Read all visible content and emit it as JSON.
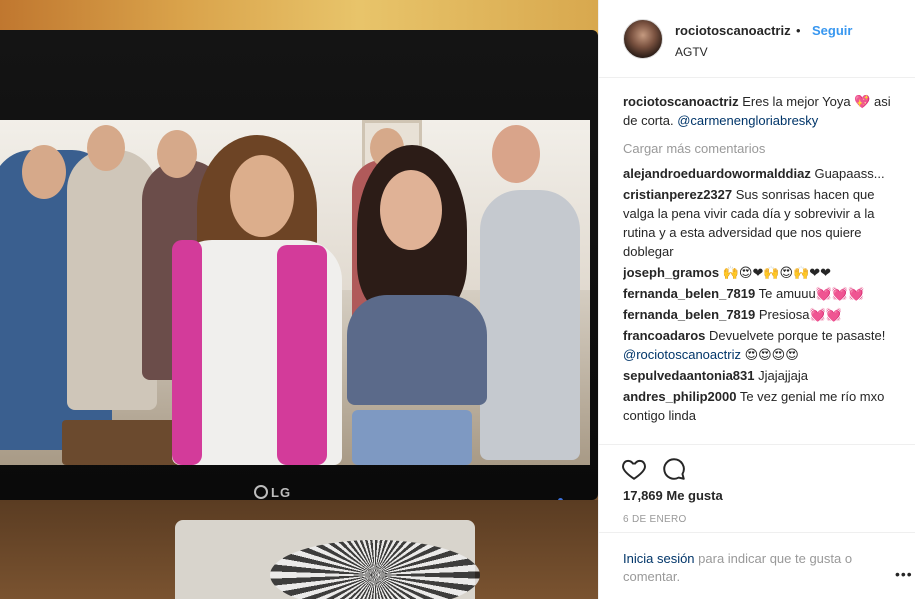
{
  "post": {
    "username": "rociotoscanoactriz",
    "separator": "•",
    "follow_label": "Seguir",
    "location": "AGTV"
  },
  "caption": {
    "user": "rociotoscanoactriz",
    "text": "Eres la mejor Yoya 💖 asi de corta.",
    "mention": "@carmenengloriabresky"
  },
  "load_more_label": "Cargar más comentarios",
  "comments": [
    {
      "user": "alejandroeduardowormalddiaz",
      "text": "Guapaass..."
    },
    {
      "user": "cristianperez2327",
      "text": "Sus sonrisas hacen que valga la pena vivir cada día y sobrevivir a la rutina y a esta adversidad que nos quiere doblegar"
    },
    {
      "user": "joseph_gramos",
      "text": "🙌😍❤🙌😍🙌❤❤"
    },
    {
      "user": "fernanda_belen_7819",
      "text": "Te amuuu💓💓💓"
    },
    {
      "user": "fernanda_belen_7819",
      "text": "Presiosa💓💓"
    },
    {
      "user": "francoadaros",
      "text": "Devuelvete porque te pasaste! ",
      "mention": "@rociotoscanoactriz",
      "after": " 😍😍😍😍"
    },
    {
      "user": "sepulvedaantonia831",
      "text": "Jjajajjaja"
    },
    {
      "user": "andres_philip2000",
      "text": "Te vez genial me río mxo contigo linda"
    }
  ],
  "likes_label": "17,869 Me gusta",
  "date_label": "6 DE ENERO",
  "login": {
    "link": "Inicia sesión",
    "text": " para indicar que te gusta o comentar."
  },
  "icons": {
    "like": "heart-outline-icon",
    "comment": "speech-bubble-icon",
    "more": "ellipsis-icon"
  },
  "photo": {
    "tv_brand": "LG"
  },
  "colors": {
    "link_blue": "#3897f0",
    "mention_navy": "#003569",
    "muted": "#999999",
    "text": "#262626"
  }
}
